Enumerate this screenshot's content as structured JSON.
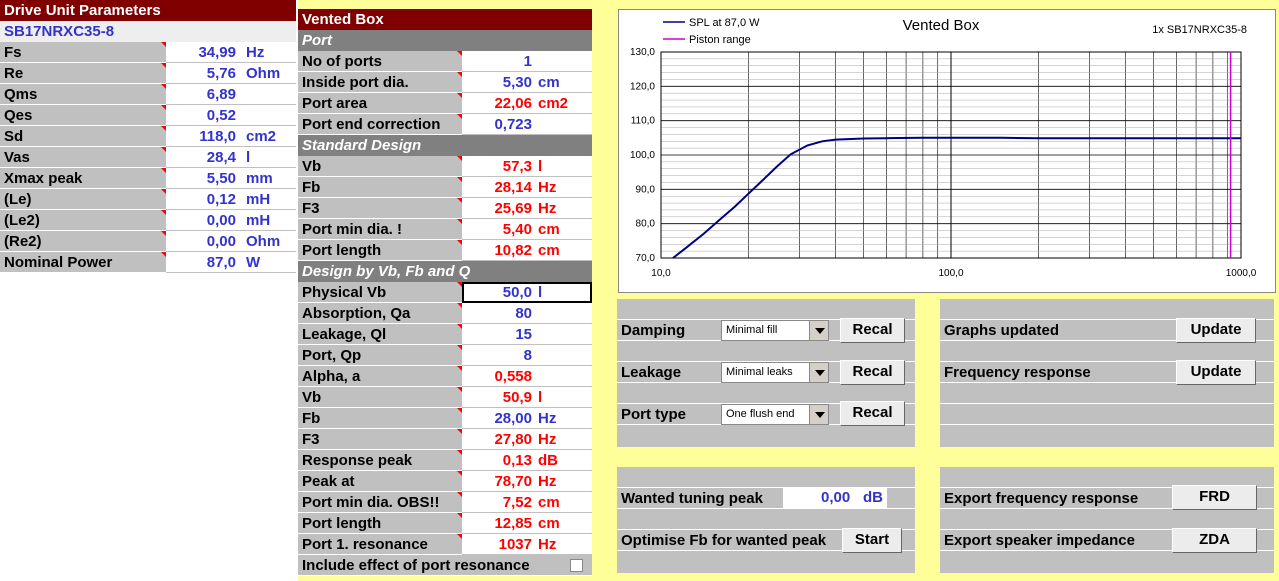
{
  "drive_unit": {
    "title": "Drive Unit Parameters",
    "model": "SB17NRXC35-8",
    "rows": [
      {
        "label": "Fs",
        "value": "34,99",
        "unit": "Hz"
      },
      {
        "label": "Re",
        "value": "5,76",
        "unit": "Ohm"
      },
      {
        "label": "Qms",
        "value": "6,89",
        "unit": ""
      },
      {
        "label": "Qes",
        "value": "0,52",
        "unit": ""
      },
      {
        "label": "Sd",
        "value": "118,0",
        "unit": "cm2"
      },
      {
        "label": "Vas",
        "value": "28,4",
        "unit": "l"
      },
      {
        "label": "Xmax peak",
        "value": "5,50",
        "unit": "mm"
      },
      {
        "label": "(Le)",
        "value": "0,12",
        "unit": "mH"
      },
      {
        "label": "(Le2)",
        "value": "0,00",
        "unit": "mH"
      },
      {
        "label": "(Re2)",
        "value": "0,00",
        "unit": "Ohm"
      },
      {
        "label": "Nominal Power",
        "value": "87,0",
        "unit": "W"
      }
    ]
  },
  "vented_box": {
    "title": "Vented Box",
    "port_header": "Port",
    "port_rows": [
      {
        "label": "No of ports",
        "value": "1",
        "unit": "",
        "color": "blue"
      },
      {
        "label": "Inside port dia.",
        "value": "5,30",
        "unit": "cm",
        "color": "blue"
      },
      {
        "label": "Port area",
        "value": "22,06",
        "unit": "cm2",
        "color": "red"
      },
      {
        "label": "Port end correction",
        "value": "0,723",
        "unit": "",
        "color": "blue"
      }
    ],
    "standard_header": "Standard Design",
    "standard_rows": [
      {
        "label": "Vb",
        "value": "57,3",
        "unit": "l",
        "color": "red"
      },
      {
        "label": "Fb",
        "value": "28,14",
        "unit": "Hz",
        "color": "red"
      },
      {
        "label": "F3",
        "value": "25,69",
        "unit": "Hz",
        "color": "red"
      },
      {
        "label": "Port min dia. !",
        "value": "5,40",
        "unit": "cm",
        "color": "red"
      },
      {
        "label": "Port length",
        "value": "10,82",
        "unit": "cm",
        "color": "red"
      }
    ],
    "design_header": "Design by Vb, Fb and Q",
    "design_rows": [
      {
        "label": "Physical Vb",
        "value": "50,0",
        "unit": "l",
        "color": "blue"
      },
      {
        "label": "Absorption, Qa",
        "value": "80",
        "unit": "",
        "color": "blue"
      },
      {
        "label": "Leakage, Ql",
        "value": "15",
        "unit": "",
        "color": "blue"
      },
      {
        "label": "Port, Qp",
        "value": "8",
        "unit": "",
        "color": "blue"
      },
      {
        "label": "Alpha, a",
        "value": "0,558",
        "unit": "",
        "color": "red"
      },
      {
        "label": "Vb",
        "value": "50,9",
        "unit": "l",
        "color": "red"
      },
      {
        "label": "Fb",
        "value": "28,00",
        "unit": "Hz",
        "color": "blue"
      },
      {
        "label": "F3",
        "value": "27,80",
        "unit": "Hz",
        "color": "red"
      },
      {
        "label": "Response peak",
        "value": "0,13",
        "unit": "dB",
        "color": "red"
      },
      {
        "label": "Peak at",
        "value": "78,70",
        "unit": "Hz",
        "color": "red"
      },
      {
        "label": "Port min dia. OBS!!",
        "value": "7,52",
        "unit": "cm",
        "color": "red"
      },
      {
        "label": "Port length",
        "value": "12,85",
        "unit": "cm",
        "color": "red"
      },
      {
        "label": "Port 1. resonance",
        "value": "1037",
        "unit": "Hz",
        "color": "red"
      }
    ],
    "port_resonance_label": "Include effect of port resonance"
  },
  "controls": {
    "damping": {
      "label": "Damping",
      "selected": "Minimal fill",
      "button": "Recal"
    },
    "leakage": {
      "label": "Leakage",
      "selected": "Minimal leaks",
      "button": "Recal"
    },
    "port_type": {
      "label": "Port type",
      "selected": "One flush end",
      "button": "Recal"
    },
    "graphs_updated": {
      "label": "Graphs updated",
      "button": "Update"
    },
    "frequency_response": {
      "label": "Frequency response",
      "button": "Update"
    },
    "wanted_tuning": {
      "label": "Wanted tuning peak",
      "value": "0,00",
      "unit": "dB"
    },
    "optimise": {
      "label": "Optimise Fb for wanted peak",
      "button": "Start"
    },
    "export_frd": {
      "label": "Export frequency response",
      "button": "FRD"
    },
    "export_zda": {
      "label": "Export speaker impedance",
      "button": "ZDA"
    }
  },
  "chart_data": {
    "type": "line",
    "title": "Vented Box",
    "subtitle": "1x SB17NRXC35-8",
    "x_scale": "log",
    "xlim": [
      10,
      1000
    ],
    "ylim": [
      70,
      130
    ],
    "x_ticks": [
      "10,0",
      "100,0",
      "1000,0"
    ],
    "y_ticks": [
      "70,0",
      "80,0",
      "90,0",
      "100,0",
      "110,0",
      "120,0",
      "130,0"
    ],
    "grid": true,
    "legend_position": "top-left",
    "series": [
      {
        "name": "SPL at 87,0 W",
        "color": "#000080",
        "x": [
          11,
          12,
          14,
          16,
          18,
          20,
          22,
          25,
          28,
          32,
          36,
          40,
          50,
          60,
          80,
          100,
          150,
          200,
          300,
          500,
          700,
          1000
        ],
        "y": [
          70,
          72.5,
          77,
          81.3,
          85,
          88.7,
          92,
          96.5,
          100.2,
          102.8,
          104,
          104.5,
          104.8,
          104.9,
          105,
          105,
          105,
          104.9,
          104.9,
          104.9,
          104.9,
          104.9
        ]
      },
      {
        "name": "Piston range",
        "color": "#cc00cc",
        "x": [
          921,
          921
        ],
        "y": [
          70,
          130
        ]
      }
    ]
  }
}
